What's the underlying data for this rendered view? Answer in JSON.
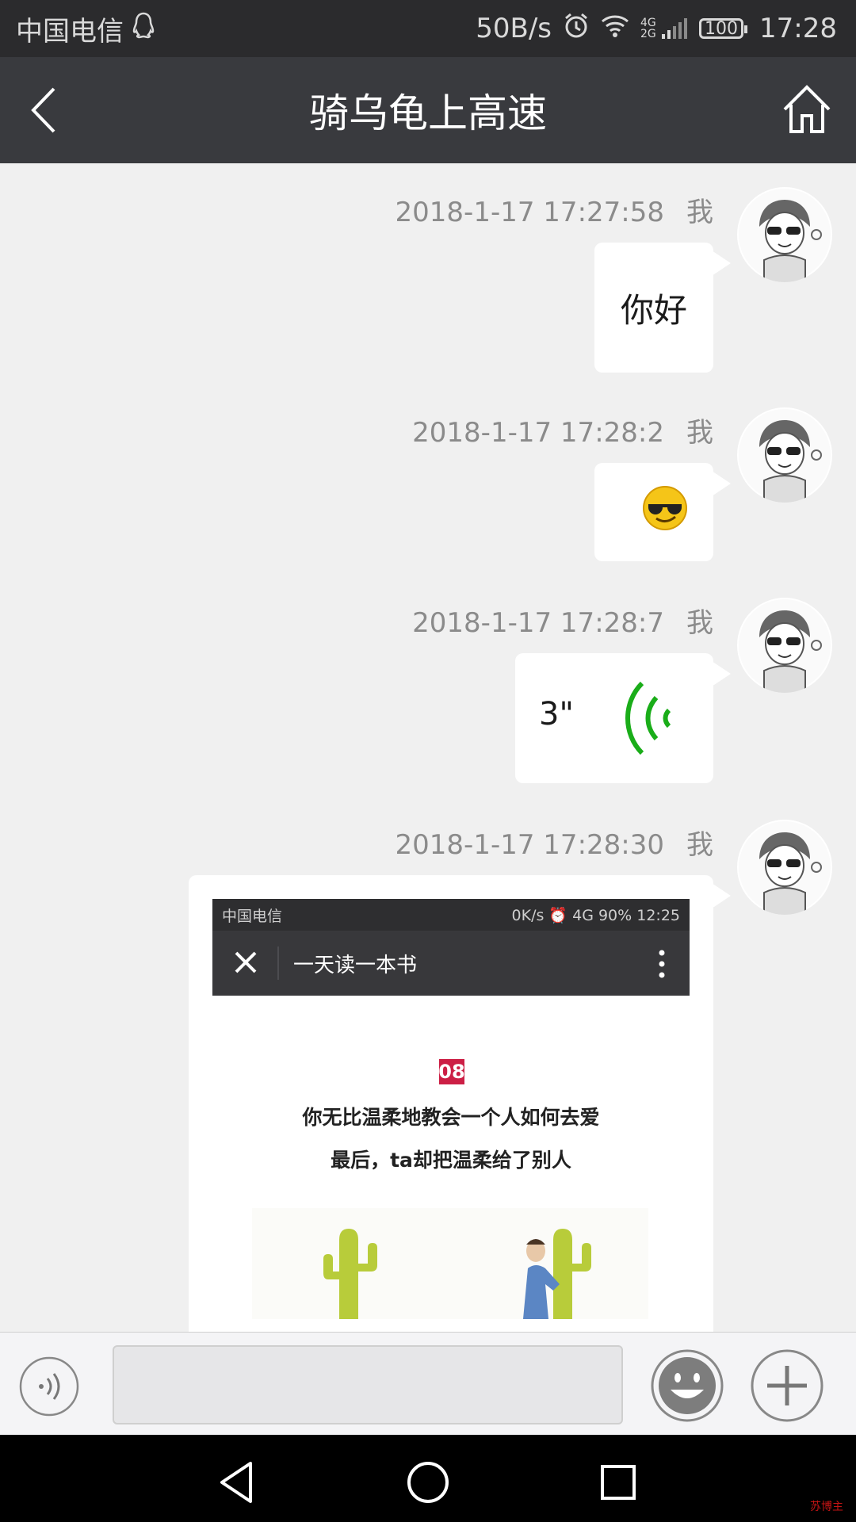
{
  "status_bar": {
    "carrier": "中国电信",
    "net_speed": "50B/s",
    "network": "4G 2G",
    "battery": "100",
    "time": "17:28"
  },
  "header": {
    "title": "骑乌龟上高速",
    "back_icon": "chevron-left-icon",
    "home_icon": "home-icon"
  },
  "messages": [
    {
      "timestamp": "2018-1-17  17:27:58",
      "sender": "我",
      "type": "text",
      "text": "你好"
    },
    {
      "timestamp": "2018-1-17  17:28:2",
      "sender": "我",
      "type": "emoji",
      "emoji": "😎"
    },
    {
      "timestamp": "2018-1-17  17:28:7",
      "sender": "我",
      "type": "voice",
      "duration": "3\""
    },
    {
      "timestamp": "2018-1-17  17:28:30",
      "sender": "我",
      "type": "image",
      "image": {
        "status_carrier": "中国电信",
        "status_right": "0K/s ⏰ 4G 90% 12:25",
        "title": "一天读一本书",
        "badge": "08",
        "line1": "你无比温柔地教会一个人如何去爱",
        "line2": "最后，ta却把温柔给了别人"
      }
    }
  ],
  "input_bar": {
    "voice_icon": "voice-mode-icon",
    "input_value": "",
    "emoji_icon": "emoji-icon",
    "plus_icon": "plus-icon"
  },
  "colors": {
    "header_bg": "#393a3e",
    "status_bg": "#2b2b2d",
    "chat_bg": "#f0f0f0",
    "voice_green": "#1aad19",
    "badge_red": "#cc1f45"
  },
  "watermark": "苏博主"
}
